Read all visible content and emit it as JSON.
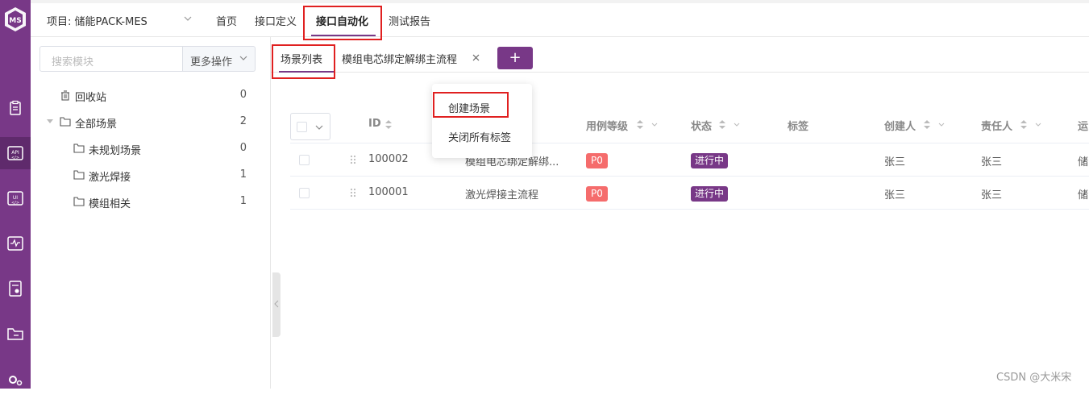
{
  "header": {
    "project_label": "项目: 储能PACK-MES",
    "menu": [
      "首页",
      "接口定义",
      "接口自动化",
      "测试报告"
    ]
  },
  "sidebar": {
    "search_placeholder": "搜索模块",
    "more_label": "更多操作",
    "recycle": {
      "label": "回收站",
      "count": "0"
    },
    "all": {
      "label": "全部场景",
      "count": "2"
    },
    "children": [
      {
        "label": "未规划场景",
        "count": "0"
      },
      {
        "label": "激光焊接",
        "count": "1"
      },
      {
        "label": "模组相关",
        "count": "1"
      }
    ]
  },
  "tabs": {
    "list_label": "场景列表",
    "open_tab_label": "模组电芯绑定解绑主流程",
    "add_label": "+"
  },
  "dropdown": {
    "items": [
      "创建场景",
      "关闭所有标签"
    ]
  },
  "table": {
    "headers": {
      "id": "ID",
      "level": "用例等级",
      "status": "状态",
      "tags": "标签",
      "creator": "创建人",
      "owner": "责任人",
      "env": "运"
    },
    "rows": [
      {
        "id": "100002",
        "name": "模组电芯绑定解绑...",
        "level": "P0",
        "status": "进行中",
        "creator": "张三",
        "owner": "张三",
        "env": "储"
      },
      {
        "id": "100001",
        "name": "激光焊接主流程",
        "level": "P0",
        "status": "进行中",
        "creator": "张三",
        "owner": "张三",
        "env": "储"
      }
    ]
  },
  "watermark": "CSDN @大米宋",
  "colors": {
    "accent": "#783887",
    "highlight": "#e02020",
    "p0": "#f56c6c"
  }
}
